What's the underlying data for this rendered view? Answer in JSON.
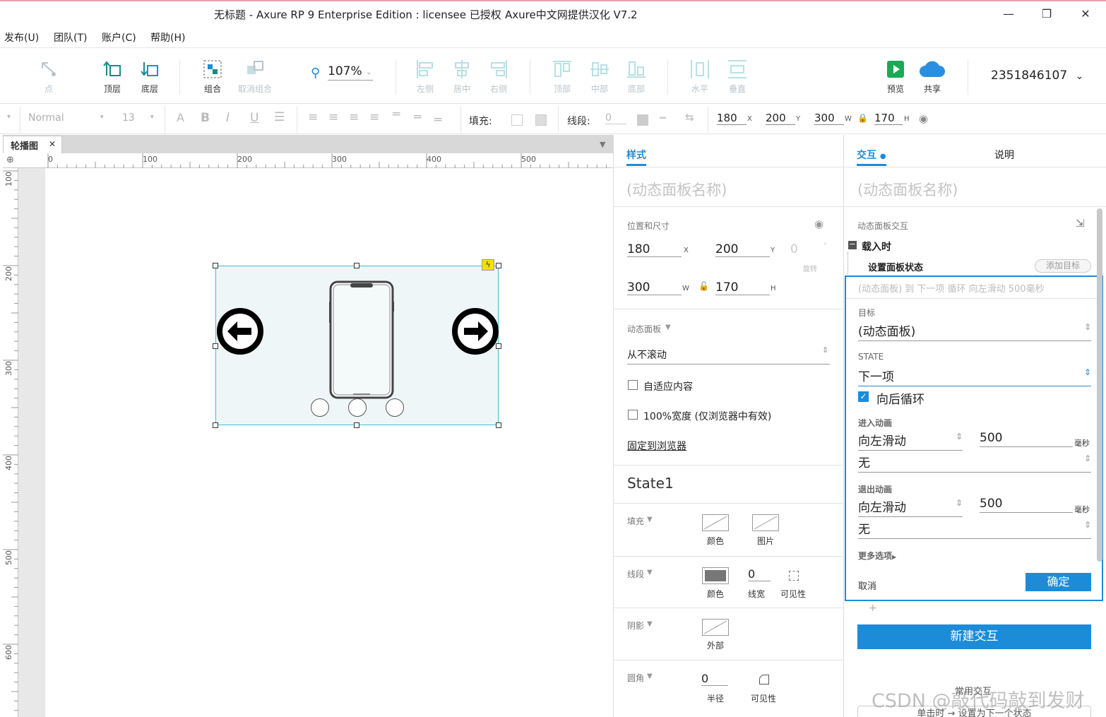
{
  "window": {
    "title": "无标题 - Axure RP 9 Enterprise Edition : licensee 已授权",
    "title2": "Axure中文网提供汉化 V7.2",
    "min_icon": "minimize-icon",
    "max_icon": "maximize-icon",
    "close_icon": "close-icon"
  },
  "menu": [
    "发布(U)",
    "团队(T)",
    "账户(C)",
    "帮助(H)"
  ],
  "toolbar": {
    "point": "点",
    "top": "顶层",
    "bottom": "底层",
    "group": "组合",
    "ungroup": "取消组合",
    "zoom": "107%",
    "align_left": "左侧",
    "align_center": "居中",
    "align_right": "右侧",
    "align_top": "顶部",
    "align_middle": "中部",
    "align_bottom": "底部",
    "dist_h": "水平",
    "dist_v": "垂直",
    "preview": "预览",
    "share": "共享",
    "user": "2351846107"
  },
  "formatbar": {
    "font": "Normal",
    "size": "13",
    "fill_label": "填充:",
    "line_label": "线段:",
    "line_value": "0",
    "x": "180",
    "x_unit": "X",
    "y": "200",
    "y_unit": "Y",
    "w": "300",
    "w_unit": "W",
    "h": "170",
    "h_unit": "H"
  },
  "canvas": {
    "tab": "轮播图",
    "ruler_h": [
      "0",
      "100",
      "200",
      "300",
      "400",
      "500"
    ],
    "ruler_v": [
      "100",
      "200",
      "300",
      "400",
      "500",
      "600"
    ]
  },
  "style_panel": {
    "tab": "样式",
    "name_placeholder": "(动态面板名称)",
    "pos_title": "位置和尺寸",
    "x": "180",
    "x_unit": "X",
    "y": "200",
    "y_unit": "Y",
    "rot": "0",
    "rot_label": "旋转",
    "w": "300",
    "w_unit": "W",
    "h": "170",
    "h_unit": "H",
    "dp_title": "动态面板",
    "scroll": "从不滚动",
    "fit": "自适应内容",
    "full_width": "100%宽度 (仅浏览器中有效)",
    "pin": "固定到浏览器",
    "state": "State1",
    "fill": "填充",
    "fill_color": "颜色",
    "fill_image": "图片",
    "line": "线段",
    "line_color": "颜色",
    "line_width_val": "0",
    "line_width": "线宽",
    "line_vis": "可见性",
    "shadow": "阴影",
    "shadow_outer": "外部",
    "radius": "圆角",
    "radius_val": "0",
    "radius_lbl": "半径",
    "radius_vis": "可见性"
  },
  "inter_panel": {
    "tab": "交互",
    "tab2": "说明",
    "name_placeholder": "(动态面板名称)",
    "section": "动态面板交互",
    "event": "载入时",
    "action": "设置面板状态",
    "add_target": "添加目标",
    "summary": "(动态面板) 到 下一项 循环 向左滑动 500毫秒",
    "target_lbl": "目标",
    "target_val": "(动态面板)",
    "state_lbl": "STATE",
    "state_val": "下一项",
    "wrap": "向后循环",
    "in_anim_lbl": "进入动画",
    "in_anim": "向左滑动",
    "in_ms": "500",
    "ms": "毫秒",
    "in_ease": "无",
    "out_anim_lbl": "退出动画",
    "out_anim": "向左滑动",
    "out_ms": "500",
    "out_ease": "无",
    "more": "更多选项",
    "cancel": "取消",
    "ok": "确定",
    "plus": "+",
    "new_int": "新建交互",
    "common": "常用交互",
    "common_item": "单击时 → 设置为下一个状态"
  },
  "watermark": "CSDN @敲代码敲到发财",
  "colors": {
    "accent": "#1c8cd9",
    "selection": "#3cc2cc",
    "preview_green": "#1aaa55"
  }
}
